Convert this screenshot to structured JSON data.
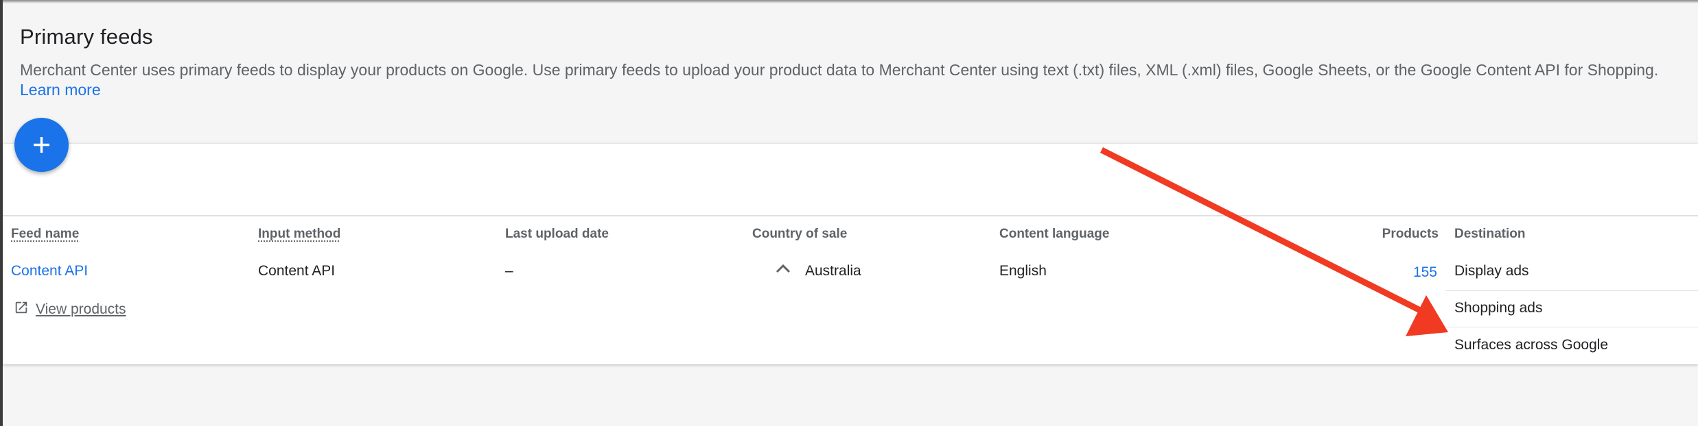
{
  "section": {
    "title": "Primary feeds",
    "description": "Merchant Center uses primary feeds to display your products on Google. Use primary feeds to upload your product data to Merchant Center using text (.txt) files, XML (.xml) files, Google Sheets, or the Google Content API for Shopping.",
    "learn_more": "Learn more"
  },
  "fab": {
    "icon": "plus-icon",
    "color": "#1a73e8"
  },
  "table": {
    "headers": {
      "feed_name": "Feed name",
      "input_method": "Input method",
      "last_upload_date": "Last upload date",
      "country_of_sale": "Country of sale",
      "content_language": "Content language",
      "products": "Products",
      "destination": "Destination"
    },
    "row": {
      "feed_name": "Content API",
      "input_method": "Content API",
      "last_upload_date": "–",
      "country_of_sale": "Australia",
      "content_language": "English",
      "products": "155",
      "destinations": [
        "Display ads",
        "Shopping ads",
        "Surfaces across Google"
      ],
      "view_products": "View products"
    }
  },
  "annotation": {
    "type": "arrow",
    "color": "#f03a22"
  }
}
